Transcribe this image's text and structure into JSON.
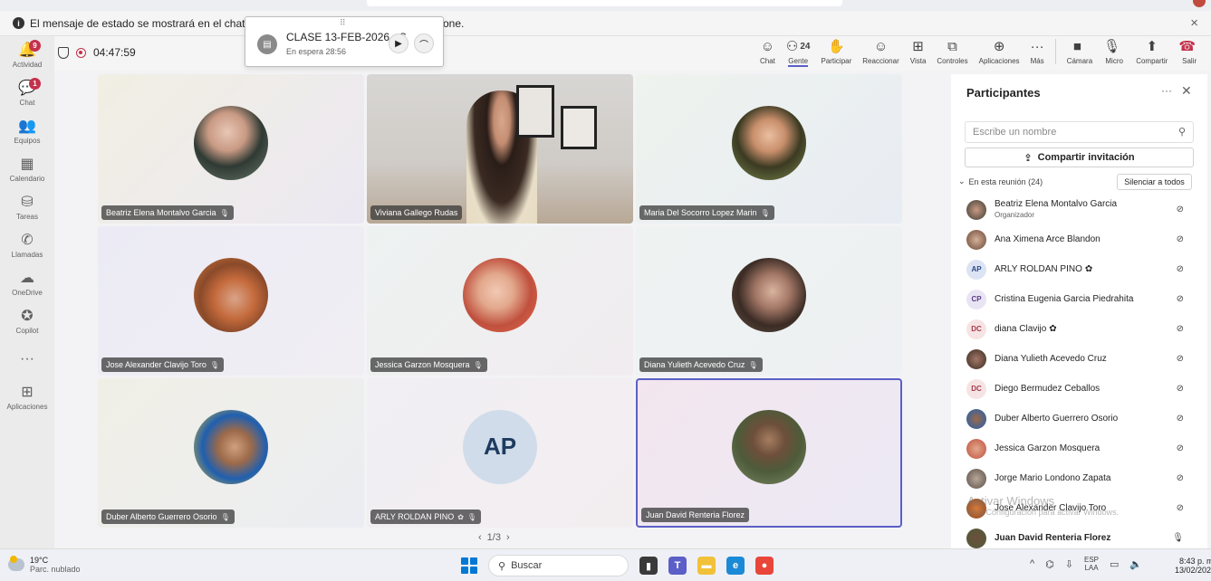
{
  "banner": {
    "text_left": "El mensaje de estado se mostrará en el chat y en los car",
    "text_right": "one.",
    "close": "×"
  },
  "rail": [
    {
      "label": "Actividad",
      "icon": "bell-icon",
      "glyph": "🔔",
      "badge": "9"
    },
    {
      "label": "Chat",
      "icon": "chat-icon",
      "glyph": "💬",
      "badge": "1"
    },
    {
      "label": "Equipos",
      "icon": "teams-icon",
      "glyph": "👥",
      "badge": ""
    },
    {
      "label": "Calendario",
      "icon": "calendar-icon",
      "glyph": "▦",
      "badge": ""
    },
    {
      "label": "Tareas",
      "icon": "tasks-icon",
      "glyph": "⛁",
      "badge": ""
    },
    {
      "label": "Llamadas",
      "icon": "phone-icon",
      "glyph": "✆",
      "badge": ""
    },
    {
      "label": "OneDrive",
      "icon": "cloud-icon",
      "glyph": "☁",
      "badge": ""
    },
    {
      "label": "Copilot",
      "icon": "copilot-icon",
      "glyph": "✪",
      "badge": ""
    },
    {
      "label": "",
      "icon": "more-icon",
      "glyph": "···",
      "badge": ""
    },
    {
      "label": "Aplicaciones",
      "icon": "add-apps-icon",
      "glyph": "⊞",
      "badge": ""
    }
  ],
  "meeting": {
    "timer": "04:47:59",
    "call": {
      "title": "CLASE 13-FEB-2026 - S",
      "status": "En espera  28:56",
      "grip": "⠿"
    }
  },
  "toolbar": [
    {
      "label": "Chat",
      "icon": "chat-bubble-icon",
      "glyph": "☺",
      "count": ""
    },
    {
      "label": "Gente",
      "icon": "people-icon",
      "glyph": "⚇",
      "count": "24",
      "active": true
    },
    {
      "label": "Participar",
      "icon": "raise-hand-icon",
      "glyph": "✋",
      "count": ""
    },
    {
      "label": "Reaccionar",
      "icon": "react-icon",
      "glyph": "☺",
      "count": ""
    },
    {
      "label": "Vista",
      "icon": "view-icon",
      "glyph": "⊞",
      "count": ""
    },
    {
      "label": "Controles",
      "icon": "controls-icon",
      "glyph": "⧉",
      "count": ""
    },
    {
      "label": "Aplicaciones",
      "icon": "apps-icon",
      "glyph": "⊕",
      "count": ""
    },
    {
      "label": "Más",
      "icon": "more-icon",
      "glyph": "···",
      "count": ""
    }
  ],
  "media": [
    {
      "label": "Cámara",
      "icon": "camera-off-icon",
      "glyph": "■"
    },
    {
      "label": "Micro",
      "icon": "mic-off-icon",
      "glyph": "🎙"
    },
    {
      "label": "Compartir",
      "icon": "share-icon",
      "glyph": "⬆"
    },
    {
      "label": "Salir",
      "icon": "hangup-icon",
      "glyph": "☎"
    }
  ],
  "tiles": [
    {
      "name": "Beatriz Elena Montalvo Garcia",
      "mute": true,
      "bg": "linear-gradient(135deg,#f1efe3,#ece8f2)",
      "photo": "radial-gradient(circle at 45% 35%,#e8c6b5 0,#c99a84 30%,#2f3a34 55%,#6c7a6b 100%)",
      "initials": "",
      "selected": false,
      "video": false
    },
    {
      "name": "Viviana Gallego Rudas",
      "mute": false,
      "bg": "linear-gradient(180deg,#d8d6d4 0%,#cfcbc6 60%,#b8a896 100%)",
      "photo": "",
      "initials": "",
      "selected": false,
      "video": true
    },
    {
      "name": "Maria Del Socorro Lopez Marin",
      "mute": true,
      "bg": "linear-gradient(135deg,#eef3ee,#e8ecf3)",
      "photo": "radial-gradient(circle at 50% 40%,#e9bfa1 0,#c98f6c 28%,#3b3a22 55%,#7c8a4f 100%)",
      "initials": "",
      "selected": false,
      "video": false
    },
    {
      "name": "Jose Alexander Clavijo Toro",
      "mute": true,
      "bg": "linear-gradient(135deg,#ecebf5,#f0eef3)",
      "photo": "radial-gradient(circle at 55% 55%,#d9a488 0,#c46a3c 35%,#8a4a2a 60%,#d47b3a 100%)",
      "initials": "",
      "selected": false,
      "video": false
    },
    {
      "name": "Jessica Garzon Mosquera",
      "mute": true,
      "bg": "linear-gradient(135deg,#edf2f1,#f1ecef)",
      "photo": "radial-gradient(circle at 45% 45%,#f2c9b4 0,#e2a88c 30%,#c0503e 60%,#e46a4a 100%)",
      "initials": "",
      "selected": false,
      "video": false
    },
    {
      "name": "Diana Yulieth Acevedo Cruz",
      "mute": true,
      "bg": "linear-gradient(135deg,#eef3f1,#eef0f3)",
      "photo": "radial-gradient(circle at 55% 45%,#d9b49e 0,#a37766 30%,#3a2b24 60%,#6b5a4f 100%)",
      "initials": "",
      "selected": false,
      "video": false
    },
    {
      "name": "Duber Alberto Guerrero Osorio",
      "mute": true,
      "bg": "linear-gradient(135deg,#f0efe6,#ecedf2)",
      "photo": "radial-gradient(circle at 55% 50%,#cfa07e 0,#9c6a4a 30%,#1f5fb0 58%,#e8c12a 100%)",
      "initials": "",
      "selected": false,
      "video": false
    },
    {
      "name": "ARLY ROLDAN PINO",
      "mute": true,
      "bg": "linear-gradient(135deg,#f1eef4,#f2eef0)",
      "photo": "",
      "initials": "AP",
      "selected": false,
      "video": false,
      "fish": true
    },
    {
      "name": "Juan David Renteria Florez",
      "mute": false,
      "bg": "linear-gradient(135deg,#f3e6ee,#ebe9f5)",
      "photo": "radial-gradient(circle at 50% 40%,#a57d60 0,#6d4f3b 28%,#4e5b3a 55%,#7c8a66 100%)",
      "initials": "",
      "selected": true,
      "video": false
    }
  ],
  "pager": {
    "prev": "‹",
    "text": "1/3",
    "next": "›"
  },
  "panel": {
    "title": "Participantes",
    "search_placeholder": "Escribe un nombre",
    "invite": "Compartir invitación",
    "section": "En esta reunión (24)",
    "mute_all": "Silenciar a todos",
    "participants": [
      {
        "name": "Beatriz Elena Montalvo Garcia",
        "role": "Organizador",
        "initials": "",
        "av": "radial-gradient(circle,#c99a84,#3c3c33)",
        "fish": false,
        "mic": "mic-off"
      },
      {
        "name": "Ana Ximena Arce Blandon",
        "role": "",
        "initials": "",
        "av": "radial-gradient(circle,#d4b19a,#6a4632)",
        "fish": false,
        "mic": "mic-off"
      },
      {
        "name": "ARLY ROLDAN PINO",
        "role": "",
        "initials": "AP",
        "av": "#dce4f3",
        "fish": true,
        "mic": "mic-off"
      },
      {
        "name": "Cristina Eugenia Garcia Piedrahita",
        "role": "",
        "initials": "CP",
        "av": "#e9e4f3",
        "fish": false,
        "mic": "mic-off"
      },
      {
        "name": "diana Clavijo",
        "role": "",
        "initials": "DC",
        "av": "#f6e3e4",
        "fish": true,
        "mic": "mic-off"
      },
      {
        "name": "Diana Yulieth Acevedo Cruz",
        "role": "",
        "initials": "",
        "av": "radial-gradient(circle,#a37766,#3a2b24)",
        "fish": false,
        "mic": "mic-off"
      },
      {
        "name": "Diego Bermudez Ceballos",
        "role": "",
        "initials": "DC",
        "av": "#f6e3e4",
        "fish": false,
        "mic": "mic-off"
      },
      {
        "name": "Duber Alberto Guerrero Osorio",
        "role": "",
        "initials": "",
        "av": "radial-gradient(circle,#9c6a4a,#1f5fb0)",
        "fish": false,
        "mic": "mic-off"
      },
      {
        "name": "Jessica Garzon Mosquera",
        "role": "",
        "initials": "",
        "av": "radial-gradient(circle,#e2a88c,#c0503e)",
        "fish": false,
        "mic": "mic-off"
      },
      {
        "name": "Jorge Mario Londono Zapata",
        "role": "",
        "initials": "",
        "av": "radial-gradient(circle,#b7a79a,#5d5048)",
        "fish": false,
        "mic": "mic-off"
      },
      {
        "name": "Jose Alexander Clavijo Toro",
        "role": "",
        "initials": "",
        "av": "radial-gradient(circle,#d47b3a,#8a4a2a)",
        "fish": false,
        "mic": "mic-off"
      },
      {
        "name": "Juan David Renteria Florez",
        "role": "",
        "initials": "",
        "av": "radial-gradient(circle,#6d4f3b,#4e5b3a)",
        "fish": false,
        "mic": "mic-on",
        "bold": true
      }
    ],
    "watermark_title": "Activar Windows",
    "watermark_sub": "Ve a Configuración para activar Windows."
  },
  "taskbar": {
    "temp": "19°C",
    "weather": "Parc. nublado",
    "search": "Buscar",
    "lang1": "ESP",
    "lang2": "LAA",
    "time": "8:43 p. m.",
    "date": "13/02/2026",
    "apps": [
      {
        "icon": "task-view-icon",
        "color": "#3a3a3a",
        "glyph": "▮"
      },
      {
        "icon": "teams-app-icon",
        "color": "#5b5fc7",
        "glyph": "T"
      },
      {
        "icon": "file-explorer-icon",
        "color": "#f2c13a",
        "glyph": "▬"
      },
      {
        "icon": "edge-icon",
        "color": "#1b8ad6",
        "glyph": "e"
      },
      {
        "icon": "chrome-icon",
        "color": "#e9463a",
        "glyph": "●"
      }
    ]
  }
}
